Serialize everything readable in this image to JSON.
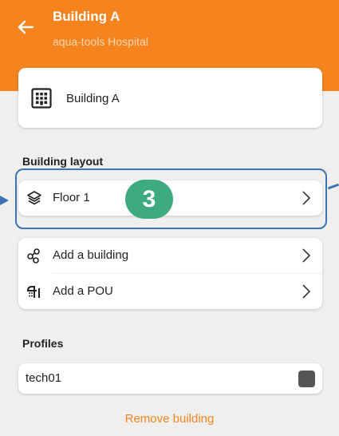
{
  "header": {
    "title": "Building A",
    "subtitle": "aqua-tools Hospital",
    "back_icon": "arrow-left-icon",
    "bg_color": "#f5841f"
  },
  "building_card": {
    "label": "Building A",
    "icon": "building-icon"
  },
  "building_layout": {
    "title": "Building layout",
    "floor": {
      "label": "Floor 1",
      "icon": "layers-icon"
    },
    "badge": "3"
  },
  "actions": [
    {
      "label": "Add a building",
      "icon": "share-nodes-icon"
    },
    {
      "label": "Add a POU",
      "icon": "shower-icon"
    }
  ],
  "profiles": {
    "title": "Profiles",
    "items": [
      {
        "name": "tech01"
      }
    ]
  },
  "remove_label": "Remove building",
  "colors": {
    "accent": "#f5841f",
    "highlight": "#3b73b4",
    "badge": "#3eaa82"
  }
}
